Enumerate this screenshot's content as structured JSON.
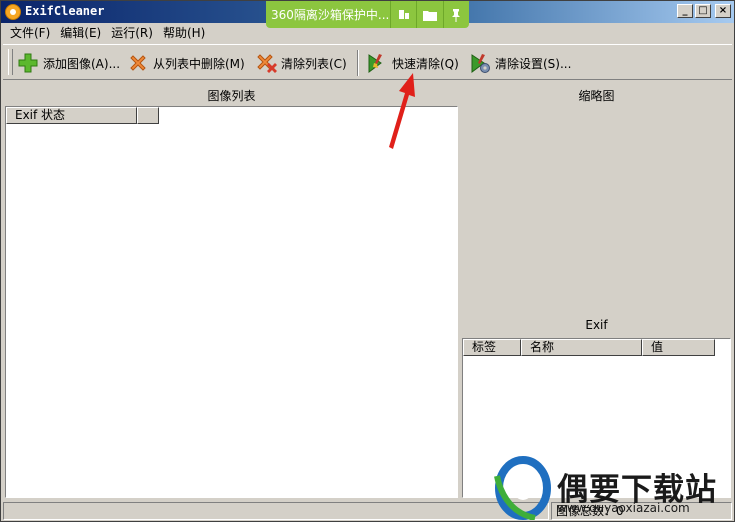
{
  "window": {
    "title": "ExifCleaner",
    "controls": {
      "minimize": "_",
      "maximize": "□",
      "close": "×"
    }
  },
  "overlay": {
    "label": "360隔离沙箱保护中..."
  },
  "menu": [
    {
      "label": "文件(F)"
    },
    {
      "label": "编辑(E)"
    },
    {
      "label": "运行(R)"
    },
    {
      "label": "帮助(H)"
    }
  ],
  "toolbar": {
    "add_images": "添加图像(A)...",
    "remove_from_list": "从列表中删除(M)",
    "clear_list": "清除列表(C)",
    "quick_clean": "快速清除(Q)",
    "clean_settings": "清除设置(S)..."
  },
  "image_list": {
    "title": "图像列表",
    "columns": [
      "Exif 状态",
      ""
    ]
  },
  "thumbnail": {
    "title": "缩略图"
  },
  "exif": {
    "title": "Exif",
    "columns": [
      "标签",
      "名称",
      "值"
    ]
  },
  "status": {
    "total_label": "图像总数：",
    "total_value": "0"
  },
  "watermark": {
    "text": "偶要下载站",
    "url": "www.ouyaoxiazai.com"
  }
}
